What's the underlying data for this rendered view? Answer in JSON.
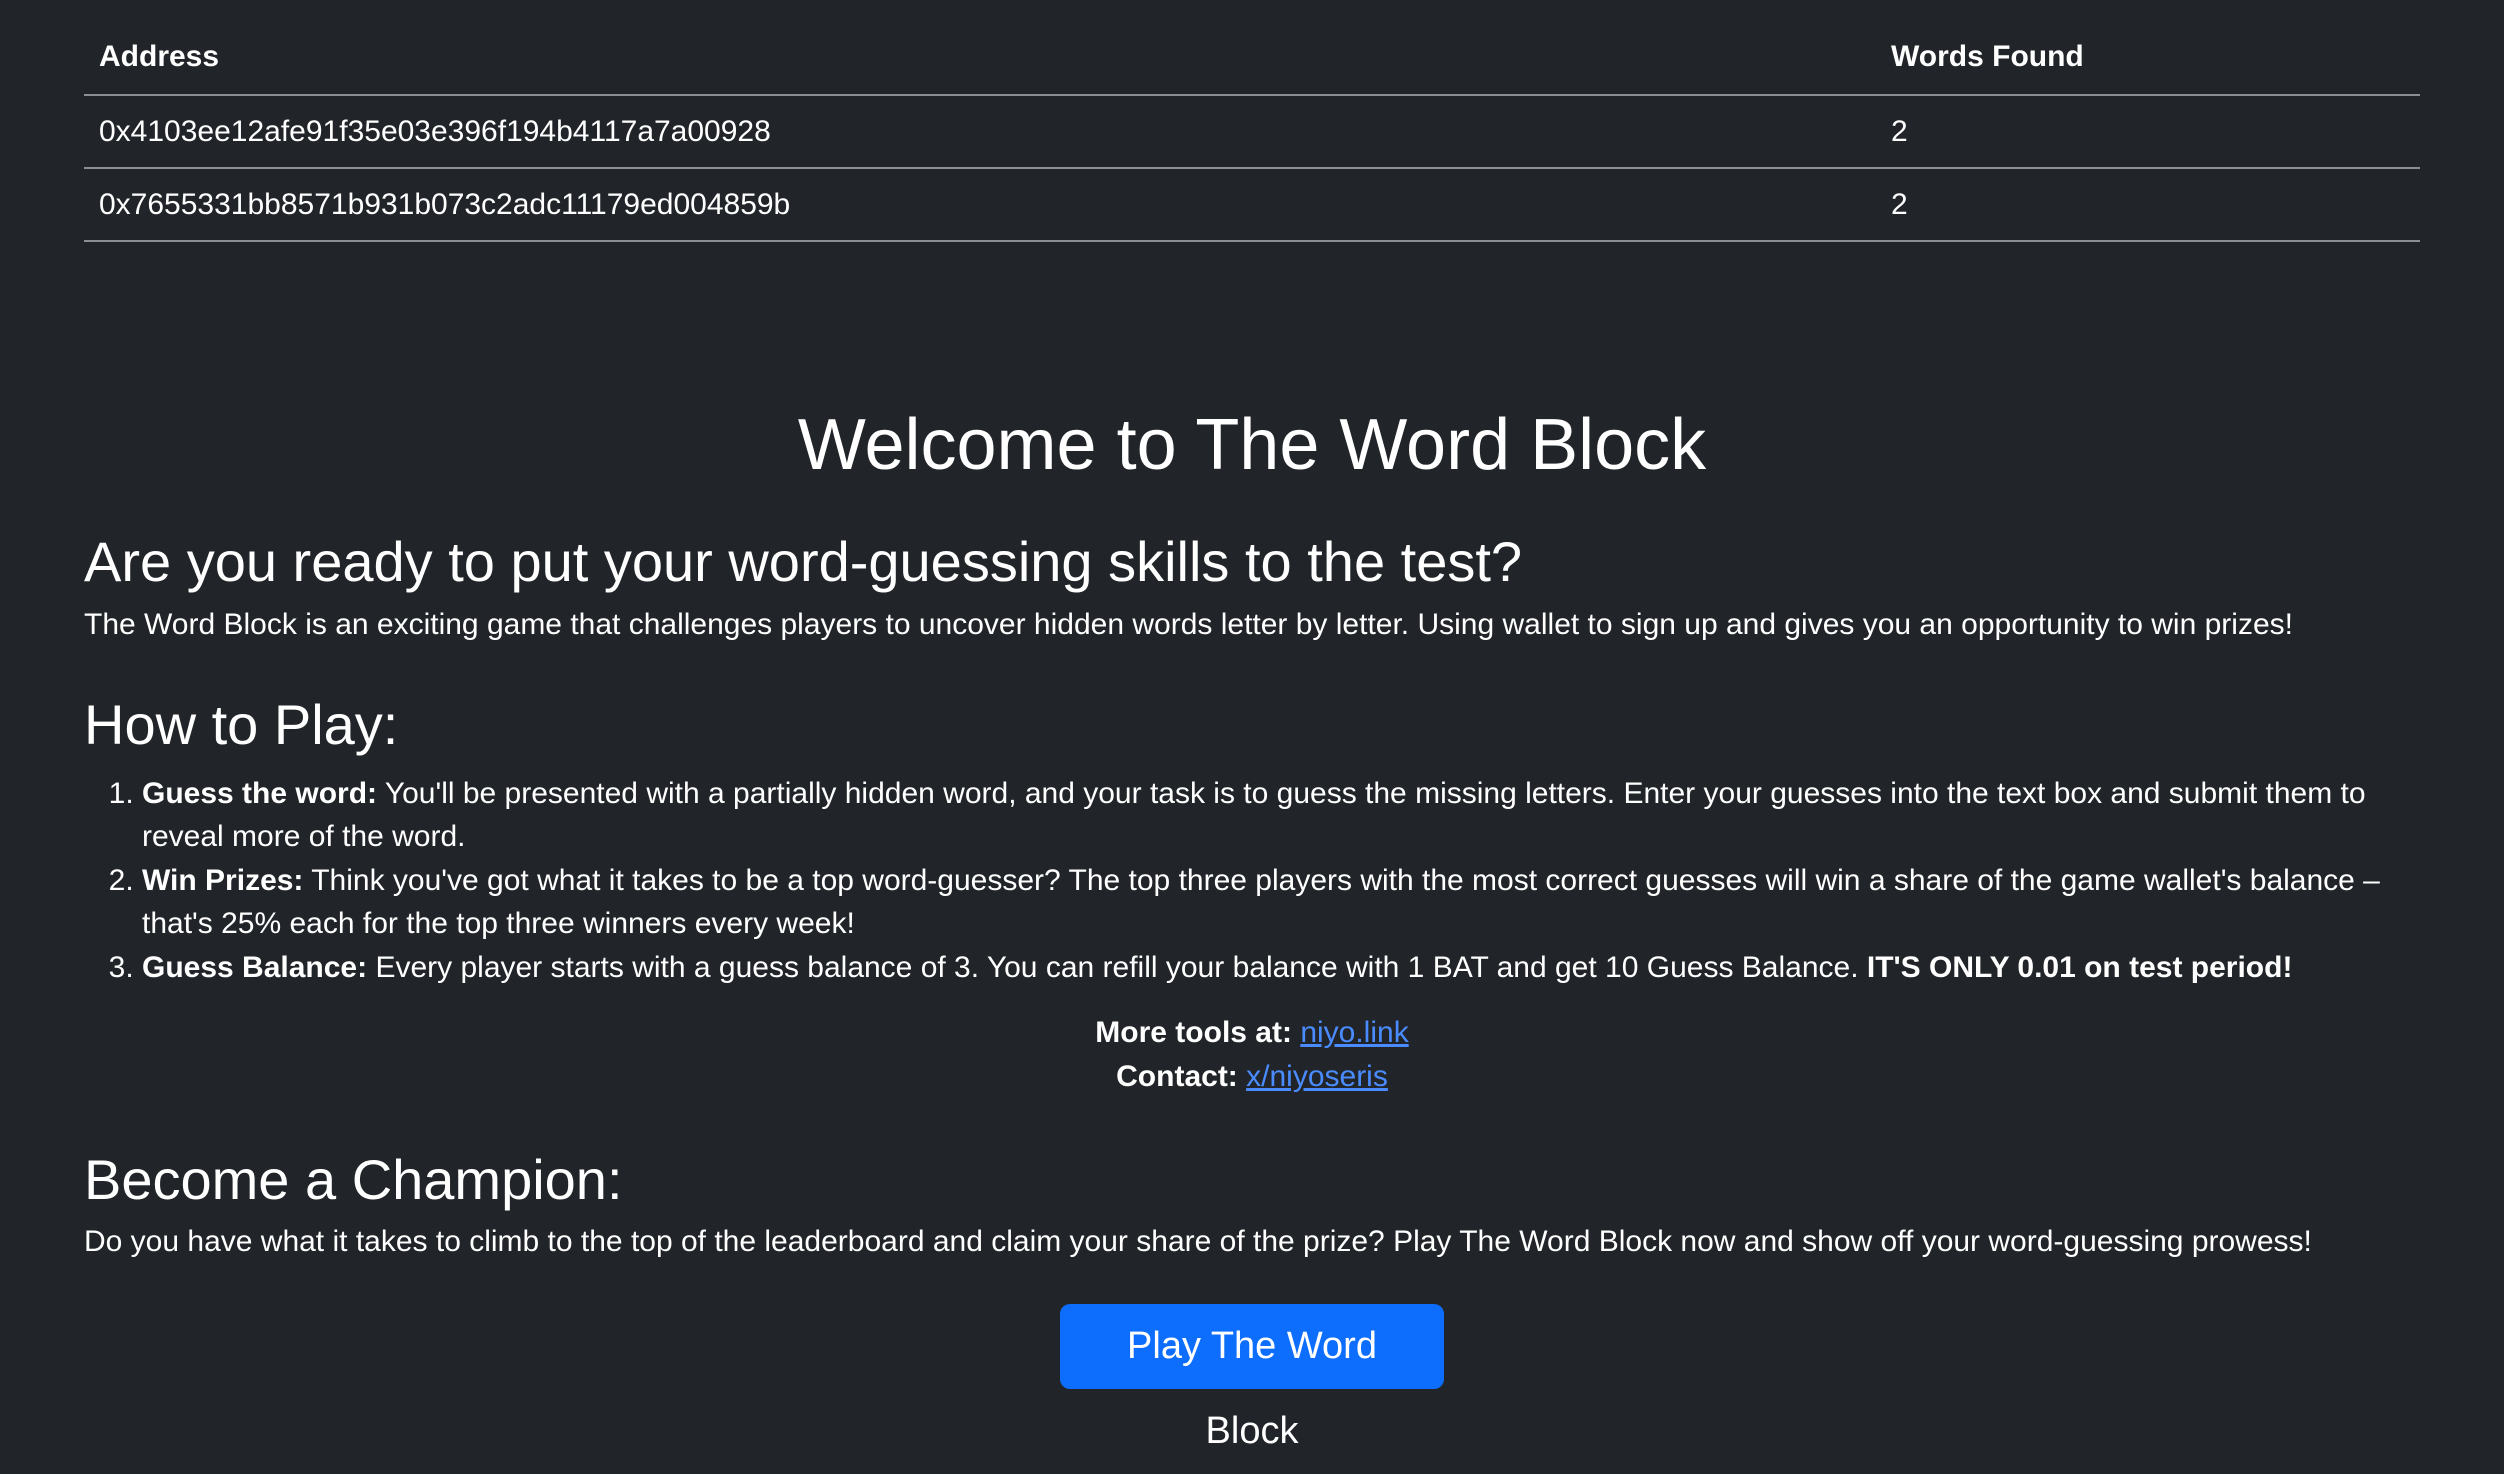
{
  "leaderboard": {
    "headers": {
      "address": "Address",
      "words_found": "Words Found"
    },
    "rows": [
      {
        "address": "0x4103ee12afe91f35e03e396f194b4117a7a00928",
        "words_found": "2"
      },
      {
        "address": "0x7655331bb8571b931b073c2adc11179ed004859b",
        "words_found": "2"
      }
    ]
  },
  "welcome_title": "Welcome to The Word Block",
  "intro": {
    "heading": "Are you ready to put your word-guessing skills to the test?",
    "text": "The Word Block is an exciting game that challenges players to uncover hidden words letter by letter. Using wallet to sign up and gives you an opportunity to win prizes!"
  },
  "how_to_play": {
    "heading": "How to Play:",
    "steps": [
      {
        "title": "Guess the word:",
        "text": " You'll be presented with a partially hidden word, and your task is to guess the missing letters. Enter your guesses into the text box and submit them to reveal more of the word."
      },
      {
        "title": "Win Prizes:",
        "text": " Think you've got what it takes to be a top word-guesser? The top three players with the most correct guesses will win a share of the game wallet's balance – that's 25% each for the top three winners every week!"
      },
      {
        "title": "Guess Balance:",
        "text": " Every player starts with a guess balance of 3. You can refill your balance with 1 BAT and get 10 Guess Balance. ",
        "emphasis": "IT'S ONLY 0.01 on test period!"
      }
    ]
  },
  "links": {
    "tools_label": "More tools at:",
    "tools_link": "niyo.link",
    "contact_label": "Contact:",
    "contact_link": "x/niyoseris",
    "link_color": "#4a8cff"
  },
  "champion": {
    "heading": "Become a Champion:",
    "text": "Do you have what it takes to climb to the top of the leaderboard and claim your share of the prize? Play The Word Block now and show off your word-guessing prowess!"
  },
  "play_button": {
    "label": "Play The Word Block",
    "color": "#0d6efd"
  },
  "colors": {
    "background": "#212529",
    "text": "#ffffff"
  }
}
